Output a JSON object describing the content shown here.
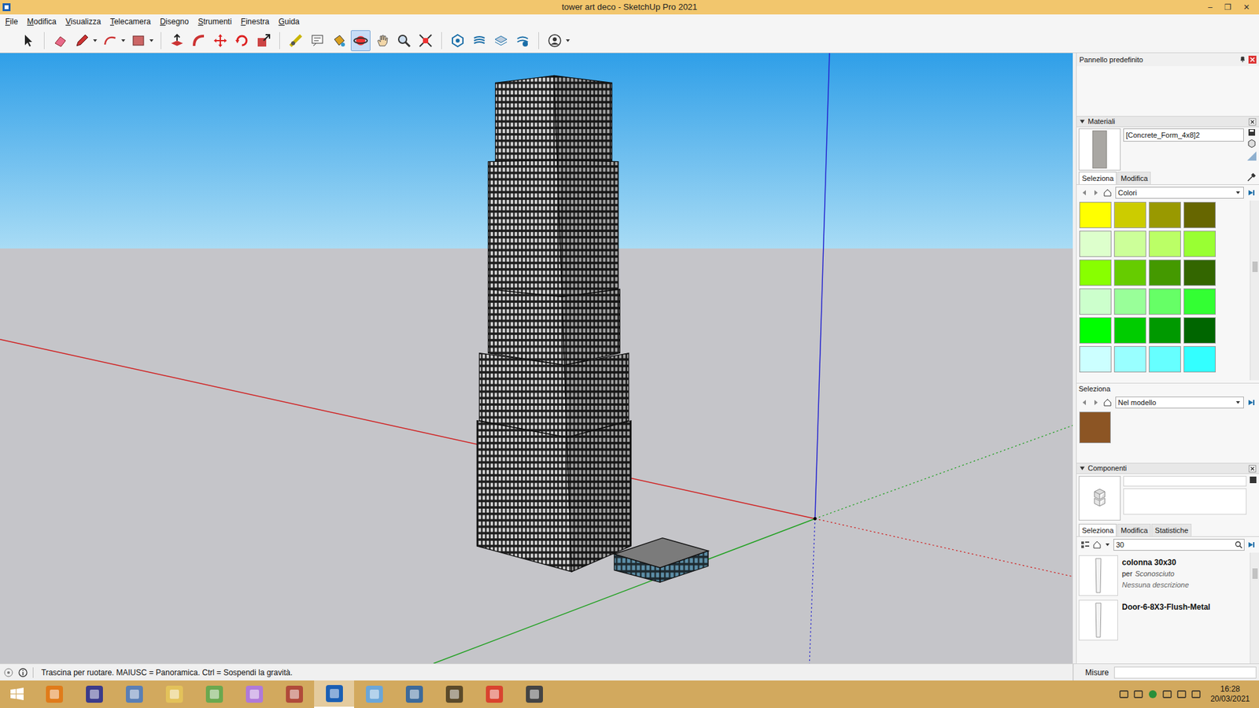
{
  "window": {
    "title": "tower art deco - SketchUp Pro 2021",
    "controls": [
      "–",
      "❐",
      "✕"
    ]
  },
  "menu": [
    "File",
    "Modifica",
    "Visualizza",
    "Telecamera",
    "Disegno",
    "Strumenti",
    "Finestra",
    "Guida"
  ],
  "toolbar": [
    {
      "selected": false,
      "dropdown": false
    },
    {
      "selected": false,
      "dropdown": false
    },
    {
      "selected": false,
      "dropdown": true
    },
    {
      "selected": false,
      "dropdown": true
    },
    {
      "selected": false,
      "dropdown": true
    },
    {
      "selected": false,
      "dropdown": false
    },
    {
      "selected": false,
      "dropdown": false
    },
    {
      "selected": false,
      "dropdown": false
    },
    {
      "selected": false,
      "dropdown": false
    },
    {
      "selected": false,
      "dropdown": false
    },
    {
      "selected": false,
      "dropdown": false
    },
    {
      "selected": false,
      "dropdown": false
    },
    {
      "selected": false,
      "dropdown": false
    },
    {
      "selected": true,
      "dropdown": false
    },
    {
      "selected": false,
      "dropdown": false
    },
    {
      "selected": false,
      "dropdown": false
    },
    {
      "selected": false,
      "dropdown": false
    },
    {
      "selected": false,
      "dropdown": false
    },
    {
      "selected": false,
      "dropdown": false
    },
    {
      "selected": false,
      "dropdown": false
    },
    {
      "selected": false,
      "dropdown": false
    },
    {
      "selected": false,
      "dropdown": true
    }
  ],
  "panel": {
    "title": "Pannello predefinito",
    "materials": {
      "header": "Materiali",
      "name": "[Concrete_Form_4x8]2",
      "tabs": [
        {
          "label": "Seleziona",
          "selected": true
        },
        {
          "label": "Modifica",
          "selected": false
        }
      ],
      "library": "Colori",
      "swatches": [
        {
          "color": "#ffff00"
        },
        {
          "color": "#cccc00"
        },
        {
          "color": "#999900"
        },
        {
          "color": "#666600"
        },
        {
          "color": "#ddffcc"
        },
        {
          "color": "#ccff99"
        },
        {
          "color": "#bbff66"
        },
        {
          "color": "#99ff33"
        },
        {
          "color": "#88ff00"
        },
        {
          "color": "#66cc00"
        },
        {
          "color": "#449900"
        },
        {
          "color": "#336600"
        },
        {
          "color": "#ccffcc"
        },
        {
          "color": "#99ff99"
        },
        {
          "color": "#66ff66"
        },
        {
          "color": "#33ff33"
        },
        {
          "color": "#00ff00"
        },
        {
          "color": "#00cc00"
        },
        {
          "color": "#009900"
        },
        {
          "color": "#006600"
        },
        {
          "color": "#ccffff"
        },
        {
          "color": "#99ffff"
        },
        {
          "color": "#66ffff"
        },
        {
          "color": "#33ffff"
        }
      ],
      "model_label": "Seleziona",
      "model_library": "Nel modello",
      "model_swatches": [
        {
          "color": "#8c5524"
        }
      ]
    },
    "components": {
      "header": "Componenti",
      "tabs": [
        {
          "label": "Seleziona",
          "selected": true
        },
        {
          "label": "Modifica",
          "selected": false
        },
        {
          "label": "Statistiche",
          "selected": false
        }
      ],
      "search": "30",
      "results": [
        {
          "name": "colonna 30x30",
          "by_label": "per",
          "author": "Sconosciuto",
          "description": "Nessuna descrizione"
        },
        {
          "name": "Door-6-8X3-Flush-Metal"
        }
      ]
    }
  },
  "status_bar": {
    "text": "Trascina per ruotare. MAIUSC = Panoramica. Ctrl = Sospendi la gravità.",
    "measure_label": "Misure"
  },
  "taskbar": {
    "apps": [
      {
        "selected": false
      },
      {
        "selected": false
      },
      {
        "selected": false
      },
      {
        "selected": false
      },
      {
        "selected": false
      },
      {
        "selected": false
      },
      {
        "selected": false
      },
      {
        "selected": true
      },
      {
        "selected": false
      },
      {
        "selected": false
      },
      {
        "selected": false
      },
      {
        "selected": false
      },
      {
        "selected": false
      }
    ],
    "time": "16:28",
    "date": "20/03/2021"
  }
}
